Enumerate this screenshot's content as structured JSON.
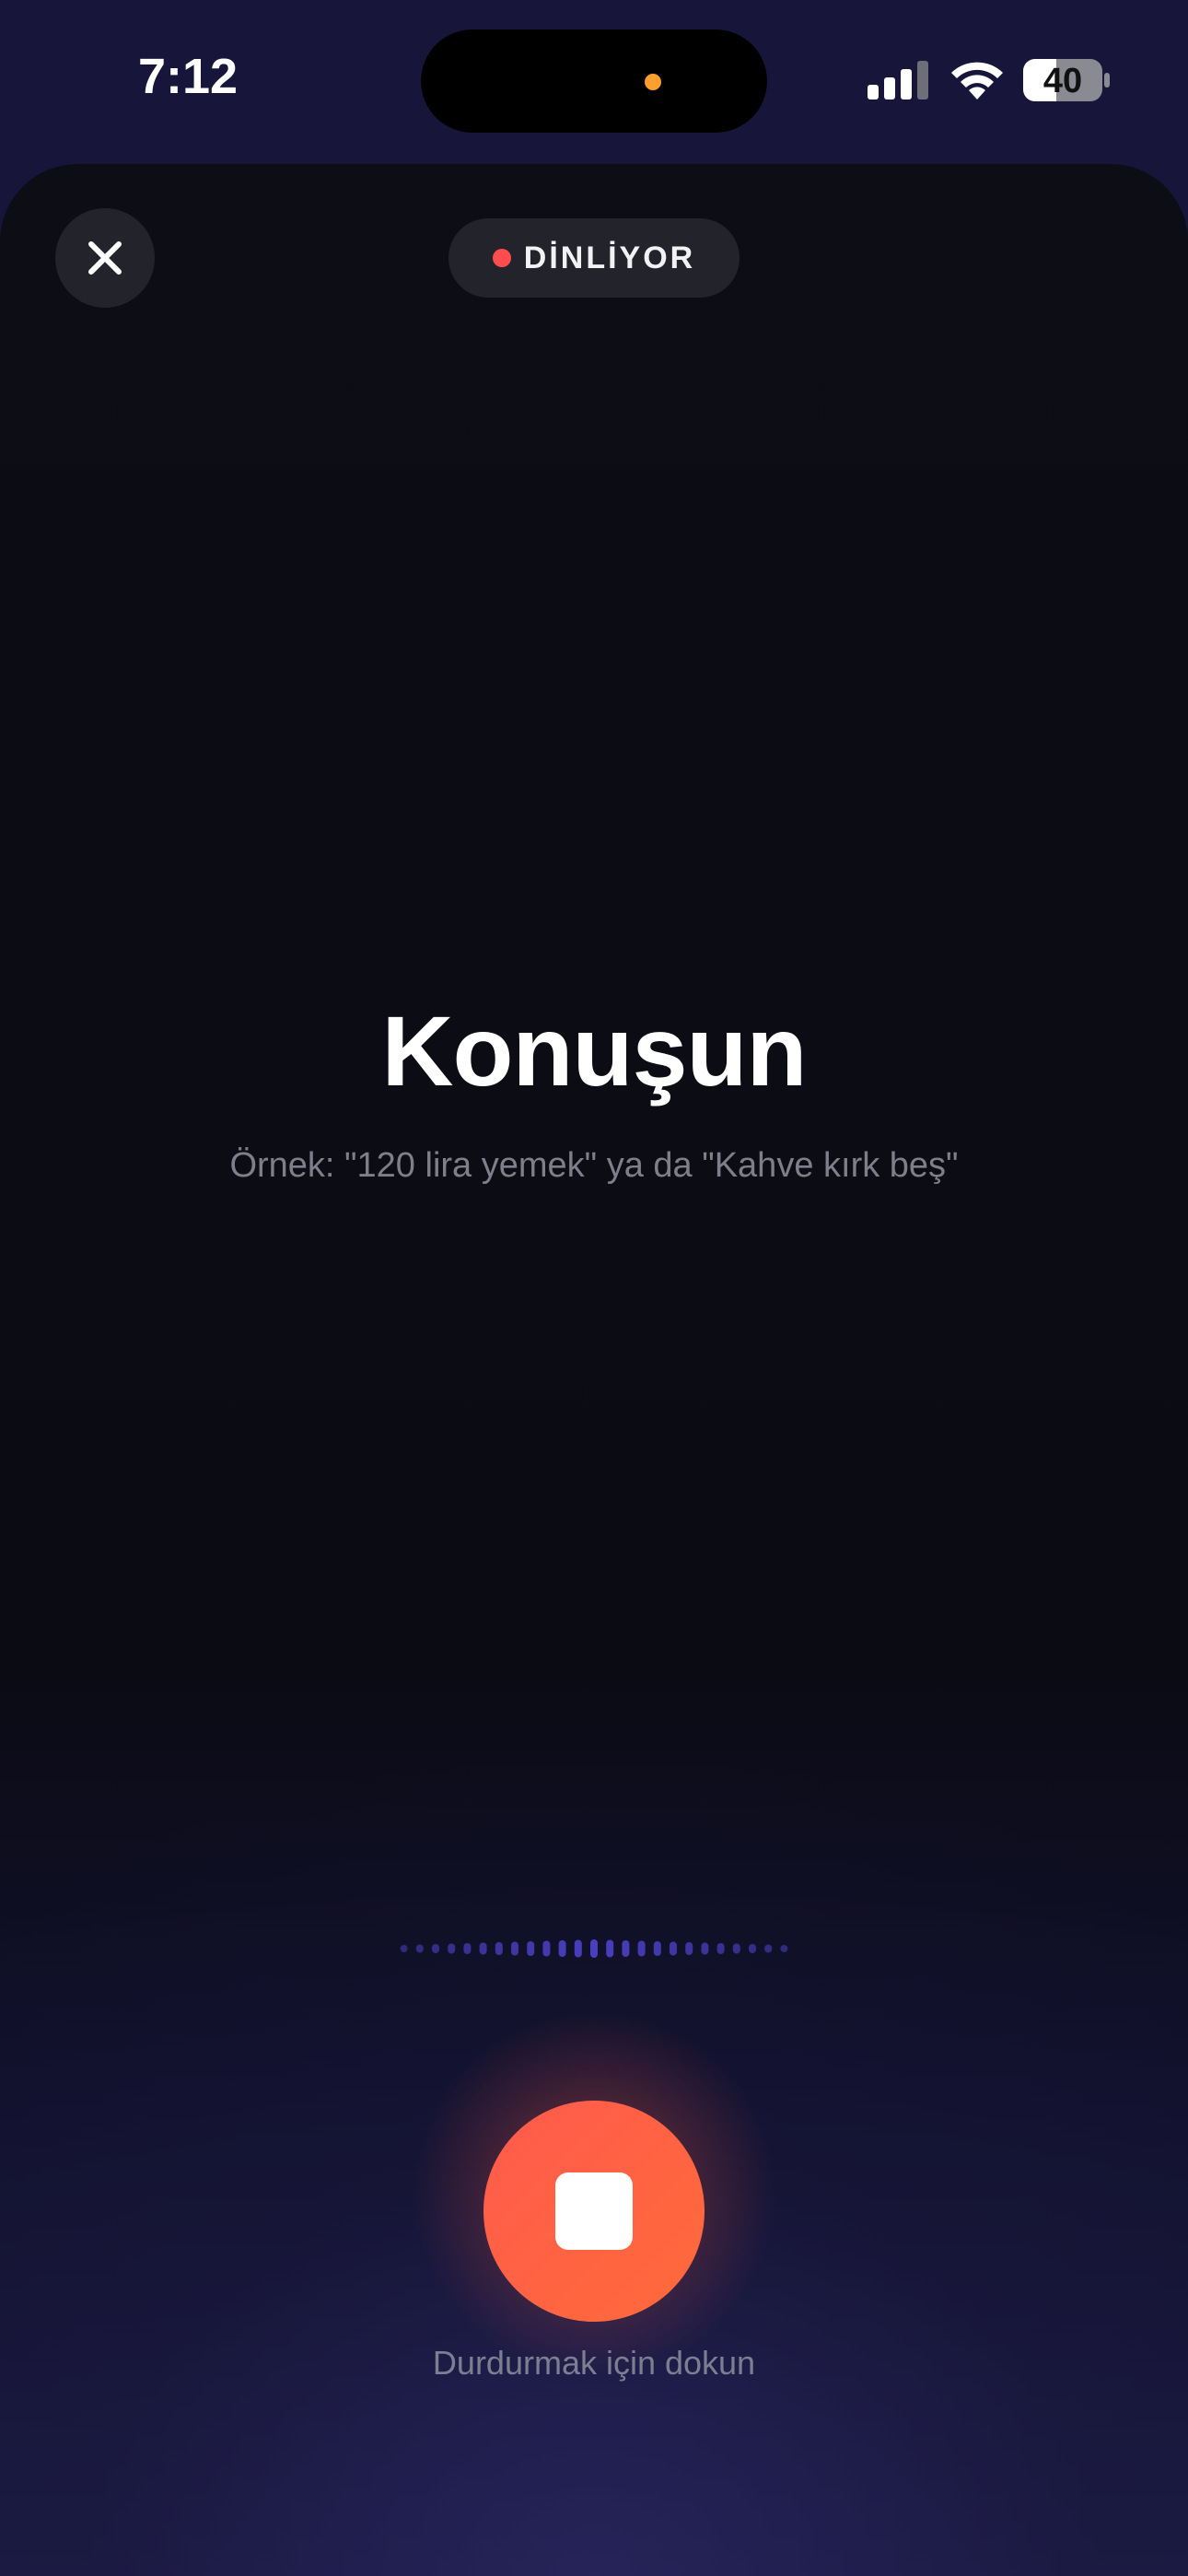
{
  "status_bar": {
    "time": "7:12",
    "battery": "40",
    "icons": [
      "signal-icon",
      "wifi-icon",
      "battery-icon"
    ]
  },
  "header": {
    "close_icon": "close-icon",
    "status_label": "DİNLİYOR"
  },
  "main": {
    "title": "Konuşun",
    "hint": "Örnek: \"120 lira yemek\" ya da \"Kahve kırk beş\""
  },
  "controls": {
    "stop_icon": "stop-icon",
    "stop_caption": "Durdurmak için dokun"
  },
  "colors": {
    "accent": "#ff5a4c",
    "recording_dot": "#ff4d4f",
    "waveform": "#4a3fc0",
    "island_indicator": "#ff9f2e"
  }
}
